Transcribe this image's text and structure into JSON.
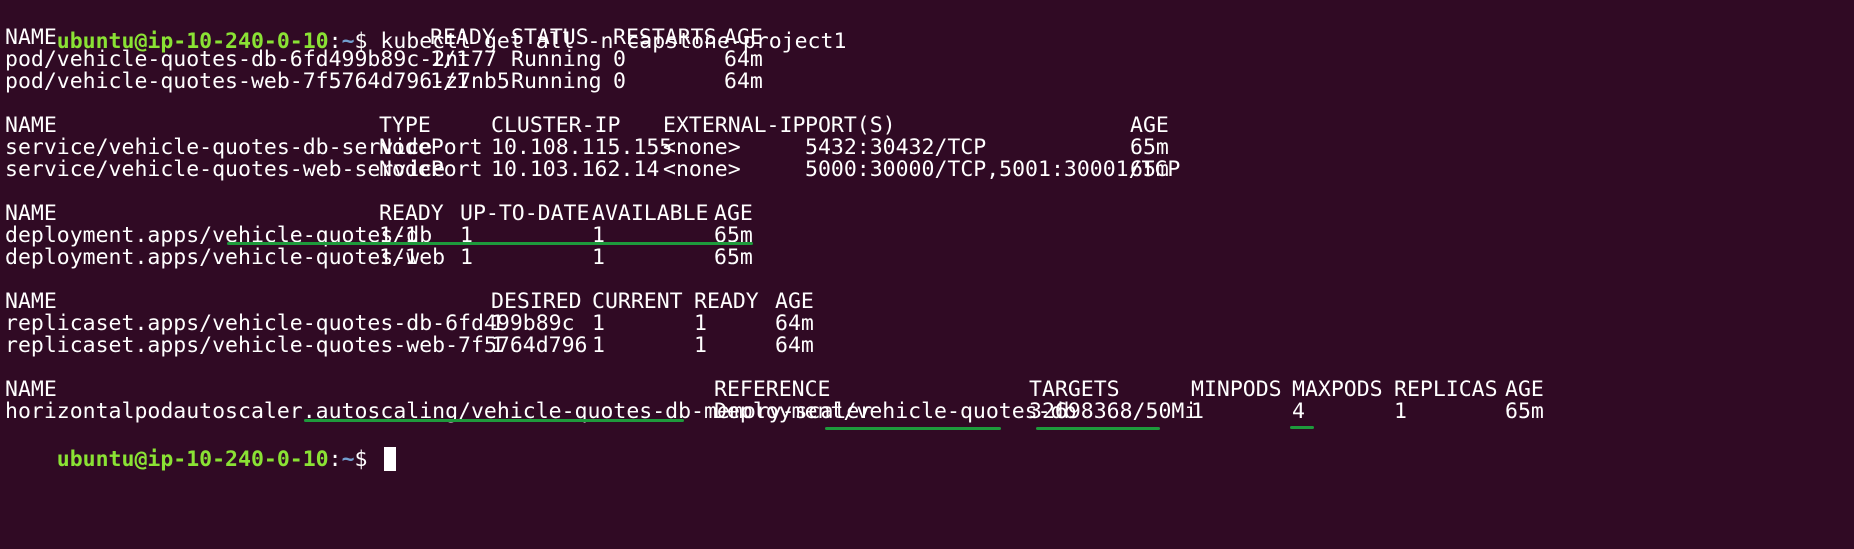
{
  "colors": {
    "background": "#300a24",
    "foreground": "#ffffff",
    "prompt_user": "#8ae234",
    "prompt_path": "#729fcf",
    "annotation": "#1e9a3c"
  },
  "prompt": {
    "user_host": "ubuntu@ip-10-240-0-10",
    "separator": ":",
    "path": "~",
    "dollar": "$ "
  },
  "command": "kubectl get all -n capstone-project1",
  "pods": {
    "headers": [
      "NAME",
      "READY",
      "STATUS",
      "RESTARTS",
      "AGE"
    ],
    "rows": [
      [
        "pod/vehicle-quotes-db-6fd499b89c-2nt77",
        "1/1",
        "Running",
        "0",
        "64m"
      ],
      [
        "pod/vehicle-quotes-web-7f5764d796-z7nb5",
        "1/1",
        "Running",
        "0",
        "64m"
      ]
    ]
  },
  "services": {
    "headers": [
      "NAME",
      "TYPE",
      "CLUSTER-IP",
      "EXTERNAL-IP",
      "PORT(S)",
      "AGE"
    ],
    "rows": [
      [
        "service/vehicle-quotes-db-service",
        "NodePort",
        "10.108.115.155",
        "<none>",
        "5432:30432/TCP",
        "65m"
      ],
      [
        "service/vehicle-quotes-web-service",
        "NodePort",
        "10.103.162.14",
        "<none>",
        "5000:30000/TCP,5001:30001/TCP",
        "65m"
      ]
    ]
  },
  "deployments": {
    "headers": [
      "NAME",
      "READY",
      "UP-TO-DATE",
      "AVAILABLE",
      "AGE"
    ],
    "rows": [
      [
        "deployment.apps/vehicle-quotes-db",
        "1/1",
        "1",
        "1",
        "65m"
      ],
      [
        "deployment.apps/vehicle-quotes-web",
        "1/1",
        "1",
        "1",
        "65m"
      ]
    ]
  },
  "replicasets": {
    "headers": [
      "NAME",
      "DESIRED",
      "CURRENT",
      "READY",
      "AGE"
    ],
    "rows": [
      [
        "replicaset.apps/vehicle-quotes-db-6fd499b89c",
        "1",
        "1",
        "1",
        "64m"
      ],
      [
        "replicaset.apps/vehicle-quotes-web-7f5764d796",
        "1",
        "1",
        "1",
        "64m"
      ]
    ]
  },
  "hpa": {
    "headers": [
      "NAME",
      "REFERENCE",
      "TARGETS",
      "MINPODS",
      "MAXPODS",
      "REPLICAS",
      "AGE"
    ],
    "rows": [
      [
        "horizontalpodautoscaler.autoscaling/vehicle-quotes-db-memory-scaler",
        "Deployment/vehicle-quotes-db",
        "32698368/50Mi",
        "1",
        "4",
        "1",
        "65m"
      ]
    ]
  }
}
